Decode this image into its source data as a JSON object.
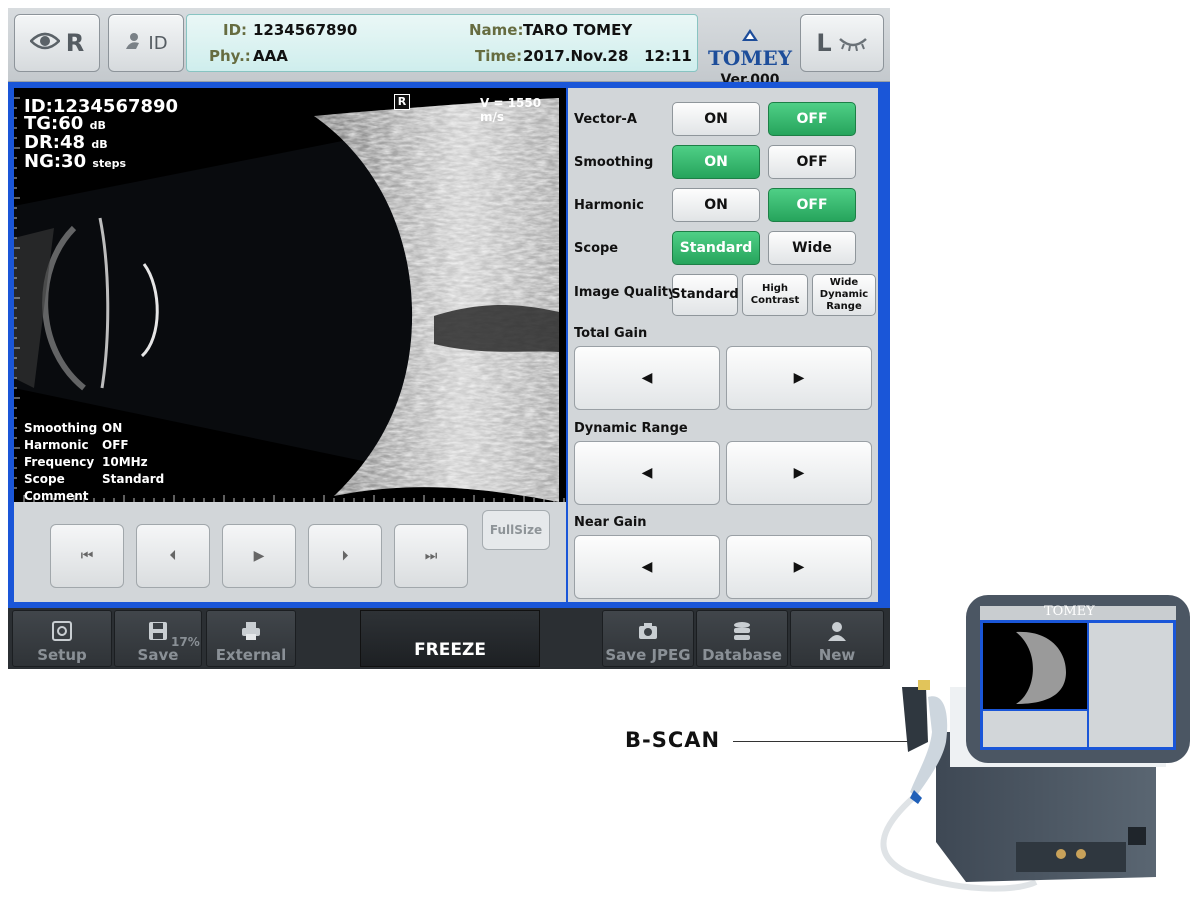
{
  "header": {
    "eye_right": "R",
    "id_button": "ID",
    "eye_left": "L",
    "patient": {
      "id_label": "ID:",
      "id_value": "1234567890",
      "name_label": "Name:",
      "name_value": "TARO TOMEY",
      "phy_label": "Phy.:",
      "phy_value": "AAA",
      "time_label": "Time:",
      "time_value": "2017.Nov.28   12:11"
    },
    "brand": "TOMEY",
    "version": "Ver.000"
  },
  "scan": {
    "id_line": "ID:1234567890",
    "tg_label": "TG:",
    "tg_value": "60",
    "tg_unit": "dB",
    "dr_label": "DR:",
    "dr_value": "48",
    "dr_unit": "dB",
    "ng_label": "NG:",
    "ng_value": "30",
    "ng_unit": "steps",
    "eye_marker": "R",
    "velocity": "V = 1550 m/s",
    "info": [
      {
        "key": "Smoothing",
        "value": "ON"
      },
      {
        "key": "Harmonic",
        "value": "OFF"
      },
      {
        "key": "Frequency",
        "value": "10MHz"
      },
      {
        "key": "Scope",
        "value": "Standard"
      },
      {
        "key": "Comment",
        "value": ""
      }
    ]
  },
  "playback": {
    "full_size": "FullSize",
    "icons": [
      "skip-to-start-icon",
      "step-back-icon",
      "play-icon",
      "step-forward-icon",
      "skip-to-end-icon"
    ],
    "glyphs": [
      "⏮",
      "⏴",
      "▶",
      "⏵",
      "⏭"
    ]
  },
  "controls": {
    "vector_a": {
      "label": "Vector-A",
      "on": "ON",
      "off": "OFF",
      "active": "OFF"
    },
    "smoothing": {
      "label": "Smoothing",
      "on": "ON",
      "off": "OFF",
      "active": "ON"
    },
    "harmonic": {
      "label": "Harmonic",
      "on": "ON",
      "off": "OFF",
      "active": "OFF"
    },
    "scope": {
      "label": "Scope",
      "standard": "Standard",
      "wide": "Wide",
      "active": "Standard"
    },
    "image_quality": {
      "label": "Image Quality",
      "standard": "Standard",
      "high_contrast": "High Contrast",
      "wide_dynamic": "Wide Dynamic Range"
    },
    "total_gain": {
      "label": "Total Gain"
    },
    "dynamic_range": {
      "label": "Dynamic Range"
    },
    "near_gain": {
      "label": "Near Gain"
    },
    "left_arrow": "◀",
    "right_arrow": "▶"
  },
  "bottom": {
    "setup": "Setup",
    "save": "Save",
    "save_percent": "17%",
    "external": "External",
    "freeze": "FREEZE",
    "save_jpeg": "Save JPEG",
    "database": "Database",
    "new": "New"
  },
  "callout": {
    "label": "B-SCAN"
  },
  "device": {
    "brand": "TOMEY"
  },
  "colors": {
    "active_green": "#2bb162",
    "frame_blue": "#1a56d8",
    "brand_blue": "#1d4d9a"
  }
}
